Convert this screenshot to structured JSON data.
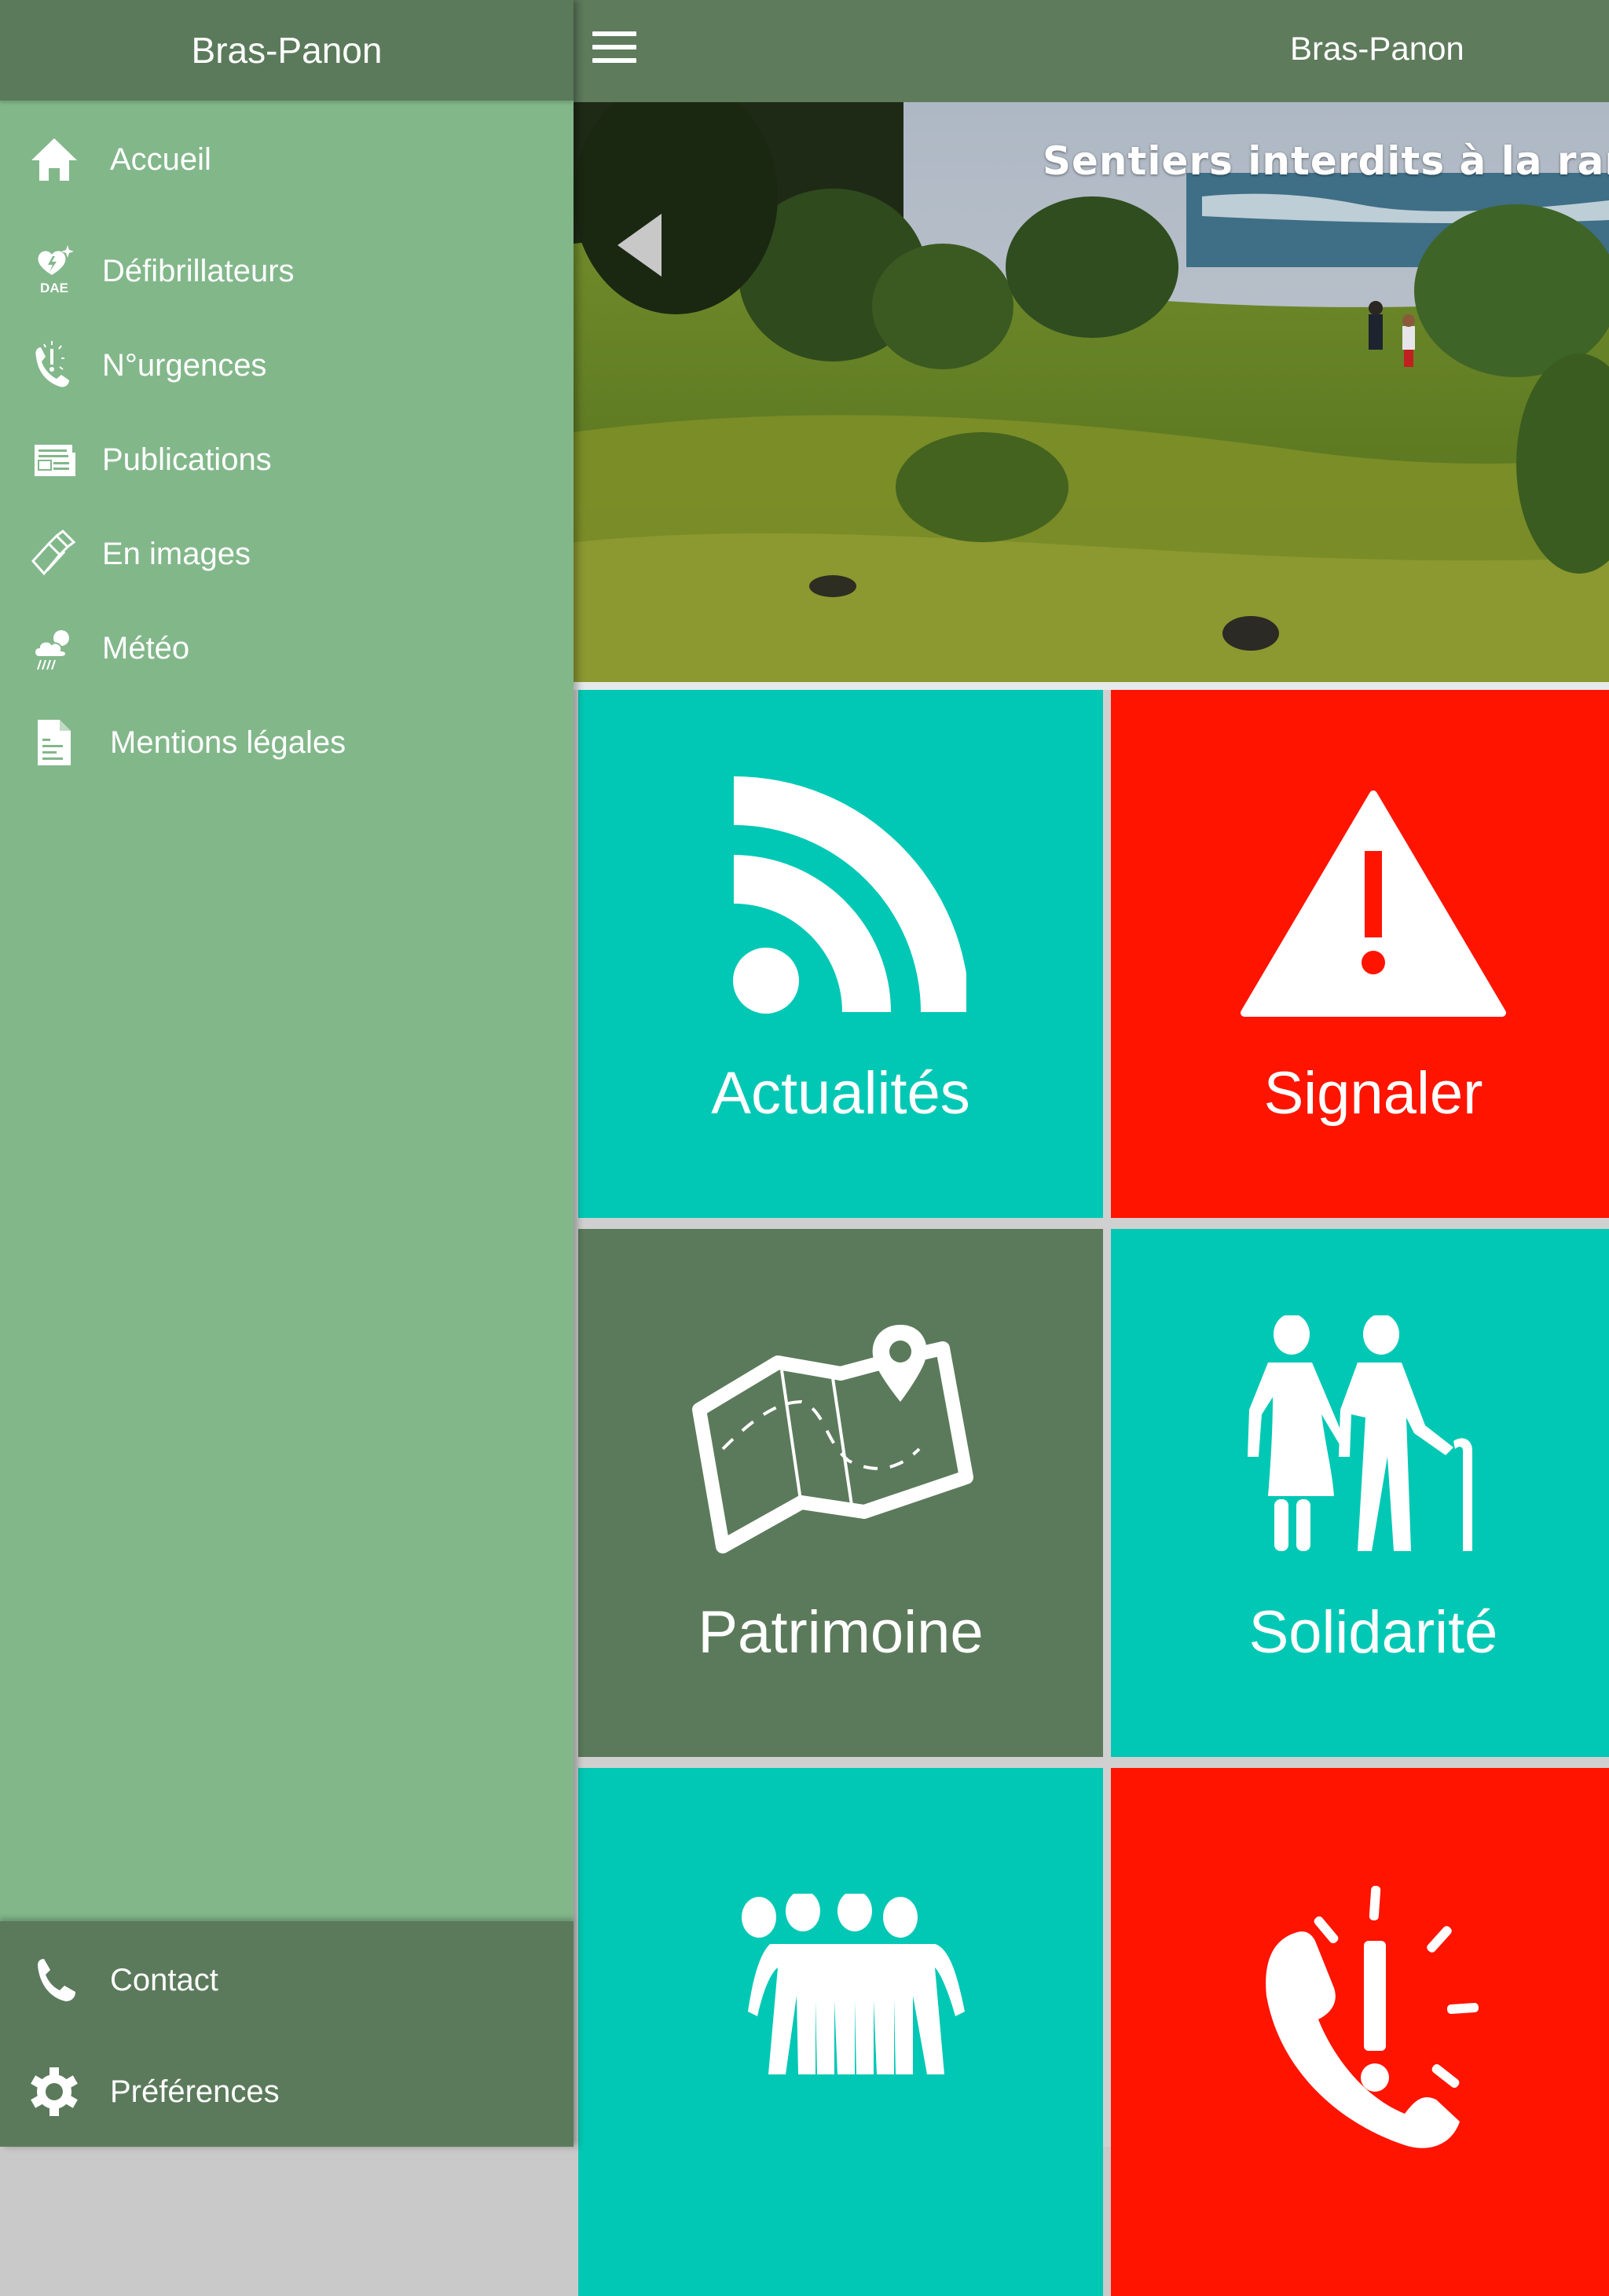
{
  "app": {
    "title": "Bras-Panon"
  },
  "sidebar": {
    "title": "Bras-Panon",
    "items": [
      {
        "label": "Accueil",
        "icon": "home-icon"
      },
      {
        "label": "Défibrillateurs",
        "icon": "defibrillator-dae-icon",
        "icon_text": "DAE"
      },
      {
        "label": "N°urgences",
        "icon": "emergency-phone-icon"
      },
      {
        "label": "Publications",
        "icon": "newspaper-icon"
      },
      {
        "label": "En images",
        "icon": "photo-album-icon"
      },
      {
        "label": "Météo",
        "icon": "weather-rain-icon"
      },
      {
        "label": "Mentions légales",
        "icon": "document-icon"
      }
    ],
    "footer_items": [
      {
        "label": "Contact",
        "icon": "phone-icon"
      },
      {
        "label": "Préférences",
        "icon": "gear-icon"
      }
    ]
  },
  "header": {
    "title": "Bras-Panon",
    "menu_icon": "hamburger-menu-icon"
  },
  "hero": {
    "caption": "Sentiers interdits à la rando",
    "prev_icon": "carousel-prev-arrow-icon"
  },
  "tiles": [
    {
      "label": "Actualités",
      "icon": "rss-feed-icon",
      "color": "#00c8b4"
    },
    {
      "label": "Signaler",
      "icon": "warning-triangle-icon",
      "color": "#ff1400"
    },
    {
      "label": "Patrimoine",
      "icon": "map-pin-icon",
      "color": "#5b7a5b"
    },
    {
      "label": "Solidarité",
      "icon": "elderly-couple-icon",
      "color": "#00c8b4"
    },
    {
      "label": "",
      "icon": "group-people-icon",
      "color": "#00c8b4"
    },
    {
      "label": "",
      "icon": "emergency-phone-icon",
      "color": "#ff1400"
    }
  ],
  "colors": {
    "sidebar_bg": "#82b78a",
    "header_bg": "#5b7a5b",
    "teal": "#00c8b4",
    "red": "#ff1400",
    "dark_green": "#5b7a5b"
  }
}
